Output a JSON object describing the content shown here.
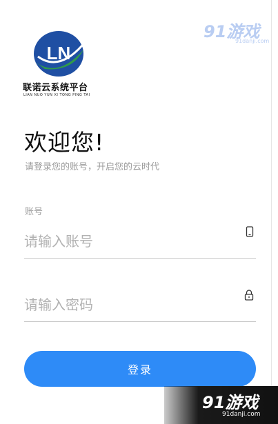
{
  "logo": {
    "title": "联诺云系统平台",
    "subtitle": "LIAN NUO YUN XI TONG PING TAI",
    "monogram": "LN",
    "icon": "globe-logo-icon"
  },
  "header": {
    "welcome": "欢迎您!",
    "subtitle": "请登录您的账号，开启您的云时代"
  },
  "form": {
    "account_label": "账号",
    "account_placeholder": "请输入账号",
    "account_icon": "phone-icon",
    "password_placeholder": "请输入密码",
    "password_icon": "lock-icon",
    "login_label": "登录"
  },
  "watermark": {
    "brand": "91游戏",
    "url": "91danji.com"
  },
  "colors": {
    "accent": "#2e8bf7",
    "logo_blue": "#1f4fa3",
    "logo_green": "#2f9a4b"
  }
}
